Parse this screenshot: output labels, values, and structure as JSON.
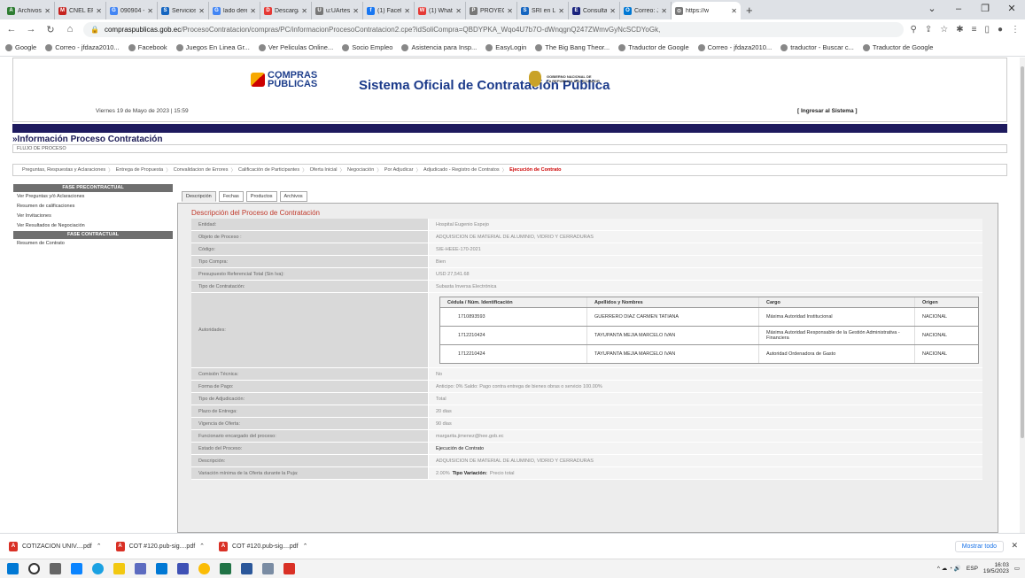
{
  "browser": {
    "tabs": [
      {
        "label": "Archivos",
        "color": "#2e7d32",
        "glyph": "A"
      },
      {
        "label": "CNEL EP",
        "color": "#c5221f",
        "glyph": "M"
      },
      {
        "label": "090904 -",
        "color": "#4285f4",
        "glyph": "G"
      },
      {
        "label": "Servicios",
        "color": "#1565c0",
        "glyph": "S"
      },
      {
        "label": "lado dere",
        "color": "#4285f4",
        "glyph": "G"
      },
      {
        "label": "Descarga",
        "color": "#e53935",
        "glyph": "D"
      },
      {
        "label": "u:UArtes",
        "color": "#777777",
        "glyph": "U"
      },
      {
        "label": "(1) Facebo",
        "color": "#1877f2",
        "glyph": "f"
      },
      {
        "label": "(1) Whats",
        "color": "#e53935",
        "glyph": "W"
      },
      {
        "label": "PROYECT",
        "color": "#777777",
        "glyph": "P"
      },
      {
        "label": "SRI en Lín",
        "color": "#1565c0",
        "glyph": "S"
      },
      {
        "label": "Consulta",
        "color": "#1a237e",
        "glyph": "E"
      },
      {
        "label": "Correo: J",
        "color": "#0078d4",
        "glyph": "O"
      },
      {
        "label": "https://w",
        "color": "#777777",
        "glyph": "⊙",
        "active": true
      }
    ],
    "url_host": "compraspublicas.gob.ec",
    "url_path": "/ProcesoContratacion/compras/PC/informacionProcesoContratacion2.cpe?idSoliCompra=QBDYPKA_Wqo4U7b7O-dWnqgnQ247ZWmvGyNcSCDYoGk,",
    "bookmarks": [
      "Google",
      "Correo - jfdaza2010...",
      "Facebook",
      "Juegos En Linea Gr...",
      "Ver Peliculas Online...",
      "Socio Empleo",
      "Asistencia para Insp...",
      "EasyLogin",
      "The Big Bang Theor...",
      "Traductor de Google",
      "Correo - jfdaza2010...",
      "traductor - Buscar c...",
      "Traductor de Google"
    ]
  },
  "site": {
    "logo_line1": "COMPRAS",
    "logo_line2": "PÚBLICAS",
    "title": "Sistema Oficial de Contratación Pública",
    "gov_line1": "GOBIERNO NACIONAL DE",
    "gov_line2": "LA REPÚBLICA DEL ECUADOR",
    "datetime": "Viernes 19 de Mayo de 2023 | 15:59",
    "login": "[ Ingresar al Sistema ]"
  },
  "process": {
    "title": "»Información Proceso Contratación",
    "flujo": "FLUJO DE PROCESO",
    "steps": [
      {
        "label": "Preguntas, Respuestas y Aclaraciones"
      },
      {
        "label": "Entrega de Propuesta"
      },
      {
        "label": "Convalidacion de Errores"
      },
      {
        "label": "Calificación de Participantes"
      },
      {
        "label": "Oferta Inicial"
      },
      {
        "label": "Negociación"
      },
      {
        "label": "Por Adjudicar"
      },
      {
        "label": "Adjudicado - Registro de Contratos"
      },
      {
        "label": "Ejecución de Contrato",
        "active": true
      }
    ]
  },
  "sidebar": {
    "head1": "FASE PRECONTRACTUAL",
    "items1": [
      "Ver Preguntas y/ó Aclaraciones",
      "Resumen de calificaciones",
      "Ver Invitaciones",
      "Ver Resultados de Negociación"
    ],
    "head2": "FASE CONTRACTUAL",
    "items2": [
      "Resumen de Contrato"
    ]
  },
  "tabs": [
    "Descripción",
    "Fechas",
    "Productos",
    "Archivos"
  ],
  "section_title": "Descripción del Proceso de Contratación",
  "fields_top": [
    {
      "label": "Entidad:",
      "value": "Hospital Eugenio Espejo"
    },
    {
      "label": "Objeto de Proceso :",
      "value": "ADQUISICION DE MATERIAL DE ALUMINIO, VIDRIO Y CERRADURAS"
    },
    {
      "label": "Código:",
      "value": "SIE-HEEE-170-2021"
    },
    {
      "label": "Tipo Compra:",
      "value": "Bien"
    },
    {
      "label": "Presupuesto Referencial Total (Sin Iva):",
      "value": "USD 27,541.68"
    },
    {
      "label": "Tipo de Contratación:",
      "value": "Subasta Inversa Electrónica"
    }
  ],
  "authorities": {
    "label": "Autoridades:",
    "headers": [
      "Cédula / Núm. Identificación",
      "Apellidos y Nombres",
      "Cargo",
      "Origen"
    ],
    "rows": [
      [
        "1710893593",
        "GUERRERO DIAZ CARMEN TATIANA",
        "Máxima Autoridad Institucional",
        "NACIONAL"
      ],
      [
        "1712210424",
        "TAYUPANTA MEJIA MARCELO IVAN",
        "Máxima Autoridad Responsable de la Gestión Administrativa - Financiera",
        "NACIONAL"
      ],
      [
        "1712210424",
        "TAYUPANTA MEJIA MARCELO IVAN",
        "Autoridad Ordenadora de Gasto",
        "NACIONAL"
      ]
    ]
  },
  "fields_bottom": [
    {
      "label": "Comisión Técnica:",
      "value": "No"
    },
    {
      "label": "Forma de Pago:",
      "value": "Anticipo: 0% Saldo: Pago contra entrega de bienes obras o servicio 100.00%"
    },
    {
      "label": "Tipo de Adjudicación:",
      "value": "Total"
    },
    {
      "label": "Plazo de Entrega:",
      "value": "20 dias"
    },
    {
      "label": "Vigencia de Oferta:",
      "value": "90 dias"
    },
    {
      "label": "Funcionario encargado del proceso:",
      "value": "margarita.jimenez@hee.gob.ec"
    },
    {
      "label": "Estado del Proceso:",
      "value": "Ejecución de Contrato",
      "dark": true
    },
    {
      "label": "Descripción:",
      "value": "ADQUISICION DE MATERIAL DE ALUMINIO, VIDRIO Y CERRADURAS"
    },
    {
      "label": "Variación mínima de la Oferta durante la Puja:",
      "value": "2.00%",
      "extra_bold": "Tipo Variación:",
      "extra": "Precio total"
    }
  ],
  "downloads": [
    "COTIZACION UNIV....pdf",
    "COT #120.pub-sig....pdf",
    "COT #120.pub-sig....pdf"
  ],
  "show_all": "Mostrar todo",
  "taskbar": {
    "lang": "ESP",
    "time": "16:03",
    "date": "19/5/2023"
  }
}
